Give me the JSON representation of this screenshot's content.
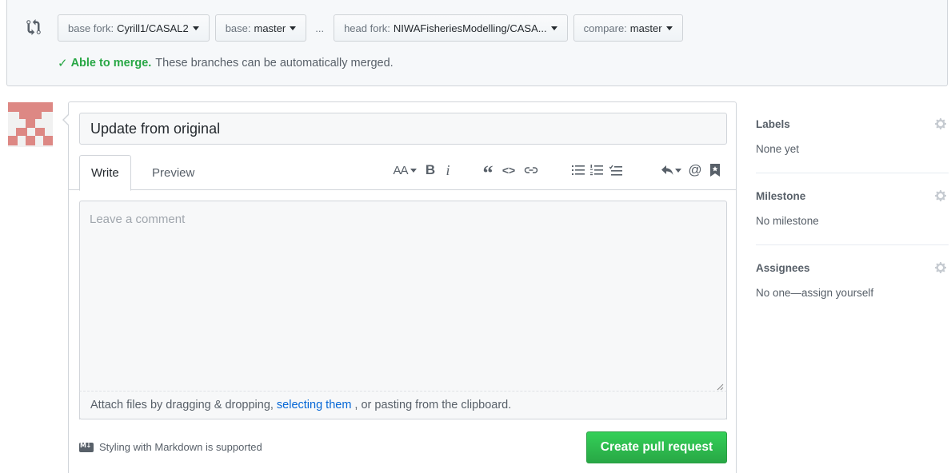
{
  "compare": {
    "base_fork": {
      "label": "base fork:",
      "value": "Cyrill1/CASAL2"
    },
    "base": {
      "label": "base:",
      "value": "master"
    },
    "ellipsis": "...",
    "head_fork": {
      "label": "head fork:",
      "value": "NIWAFisheriesModelling/CASA..."
    },
    "compare": {
      "label": "compare:",
      "value": "master"
    },
    "merge_status": {
      "check": "✓",
      "strong": "Able to merge.",
      "text": "These branches can be automatically merged."
    }
  },
  "form": {
    "title_value": "Update from original",
    "tabs": {
      "write": "Write",
      "preview": "Preview"
    },
    "comment_placeholder": "Leave a comment",
    "attach": {
      "before": "Attach files by dragging & dropping,",
      "link": "selecting them",
      "after": ", or pasting from the clipboard."
    },
    "markdown_note": "Styling with Markdown is supported",
    "markdown_badge": "M↓",
    "submit_label": "Create pull request"
  },
  "toolbar": {
    "header": "AA",
    "bold": "B",
    "italic": "i",
    "quote": "“",
    "code": "<>",
    "mention": "@"
  },
  "sidebar": {
    "labels": {
      "heading": "Labels",
      "value": "None yet"
    },
    "milestone": {
      "heading": "Milestone",
      "value": "No milestone"
    },
    "assignees": {
      "heading": "Assignees",
      "value": "No one—assign yourself"
    }
  },
  "colors": {
    "success": "#28a745",
    "link": "#0366d6",
    "avatar": "#dd8884"
  }
}
